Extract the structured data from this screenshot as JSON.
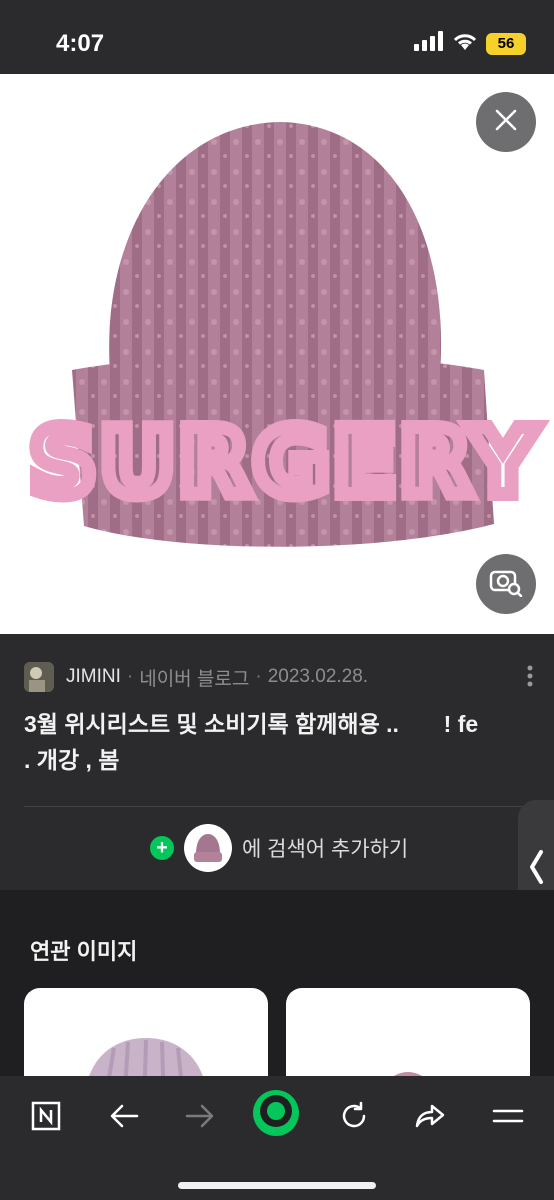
{
  "status_bar": {
    "time": "4:07",
    "battery": "56"
  },
  "hero": {
    "embroidered_text": "SURGERY",
    "hat_color": "#b07e98",
    "text_color": "#e9a0c2"
  },
  "post": {
    "author": "JIMINI",
    "separator": "·",
    "source": "네이버 블로그",
    "date": "2023.02.28.",
    "title_line1": "3월 위시리스트 및 소비기록 함께해용 ..       ! fe",
    "title_line2": ". 개강 , 봄"
  },
  "add_search": {
    "plus": "+",
    "label": "에 검색어 추가하기"
  },
  "related": {
    "title": "연관 이미지"
  },
  "colors": {
    "accent_green": "#03c75a",
    "background": "#2b2b2d"
  }
}
